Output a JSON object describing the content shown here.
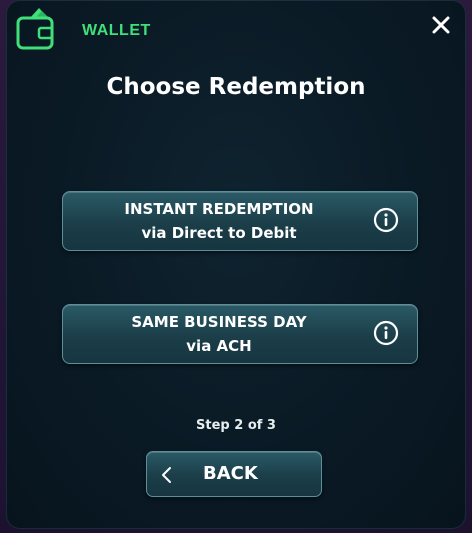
{
  "header": {
    "wallet_label": "WALLET",
    "wallet_icon": "wallet-icon",
    "close_icon": "close-icon"
  },
  "title": "Choose Redemption",
  "options": [
    {
      "line1": "INSTANT REDEMPTION",
      "line2": "via Direct to Debit",
      "icon": "info-icon"
    },
    {
      "line1": "SAME BUSINESS DAY",
      "line2": "via ACH",
      "icon": "info-icon"
    }
  ],
  "step": "Step 2 of 3",
  "back": {
    "label": "BACK",
    "icon": "chevron-left-icon"
  },
  "colors": {
    "accent_green": "#3fe07a",
    "button_top": "#2a5a66",
    "button_bottom": "#163540",
    "button_border": "#5d8f9a",
    "panel_bg": "#0a1a25",
    "frame_bg": "#2b1a3e",
    "text": "#ffffff"
  }
}
